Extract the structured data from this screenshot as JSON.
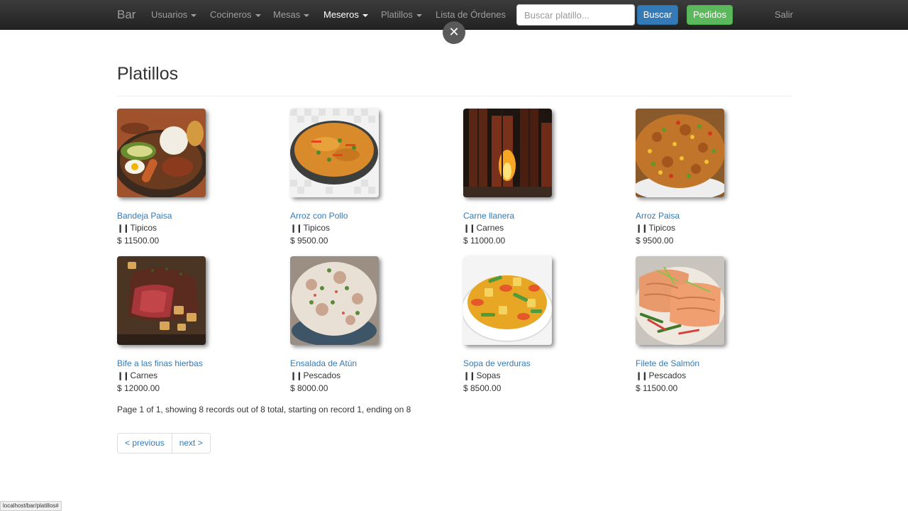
{
  "navbar": {
    "brand": "Bar",
    "items": [
      {
        "label": "Usuarios",
        "dropdown": true
      },
      {
        "label": "Cocineros",
        "dropdown": true
      },
      {
        "label": "Mesas",
        "dropdown": true
      },
      {
        "label": "Meseros",
        "dropdown": true,
        "active": true
      },
      {
        "label": "Platillos",
        "dropdown": true
      },
      {
        "label": "Lista de Órdenes",
        "dropdown": false
      }
    ],
    "search_placeholder": "Buscar platillo...",
    "search_button": "Buscar",
    "orders_button": "Pedidos",
    "logout": "Salir"
  },
  "close_badge": "✕",
  "page": {
    "title": "Platillos",
    "dishes": [
      {
        "name": "Bandeja Paisa",
        "category": "Tipicos",
        "price": "$ 11500.00"
      },
      {
        "name": "Arroz con Pollo",
        "category": "Tipicos",
        "price": "$ 9500.00"
      },
      {
        "name": "Carne llanera",
        "category": "Carnes",
        "price": "$ 11000.00"
      },
      {
        "name": "Arroz Paisa",
        "category": "Tipicos",
        "price": "$ 9500.00"
      },
      {
        "name": "Bife a las finas hierbas",
        "category": "Carnes",
        "price": "$ 12000.00"
      },
      {
        "name": "Ensalada de Atún",
        "category": "Pescados",
        "price": "$ 8000.00"
      },
      {
        "name": "Sopa de verduras",
        "category": "Sopas",
        "price": "$ 8500.00"
      },
      {
        "name": "Filete de Salmón",
        "category": "Pescados",
        "price": "$ 11500.00"
      }
    ],
    "pagination_info": "Page 1 of 1, showing 8 records out of 8 total, starting on record 1, ending on 8",
    "prev": "< previous",
    "next": "next >"
  },
  "status_bar_url": "localhost/bar/platillos#",
  "colors": {
    "link": "#337ab7",
    "primary": "#337ab7",
    "success": "#5cb85c",
    "navbar": "#222222"
  }
}
